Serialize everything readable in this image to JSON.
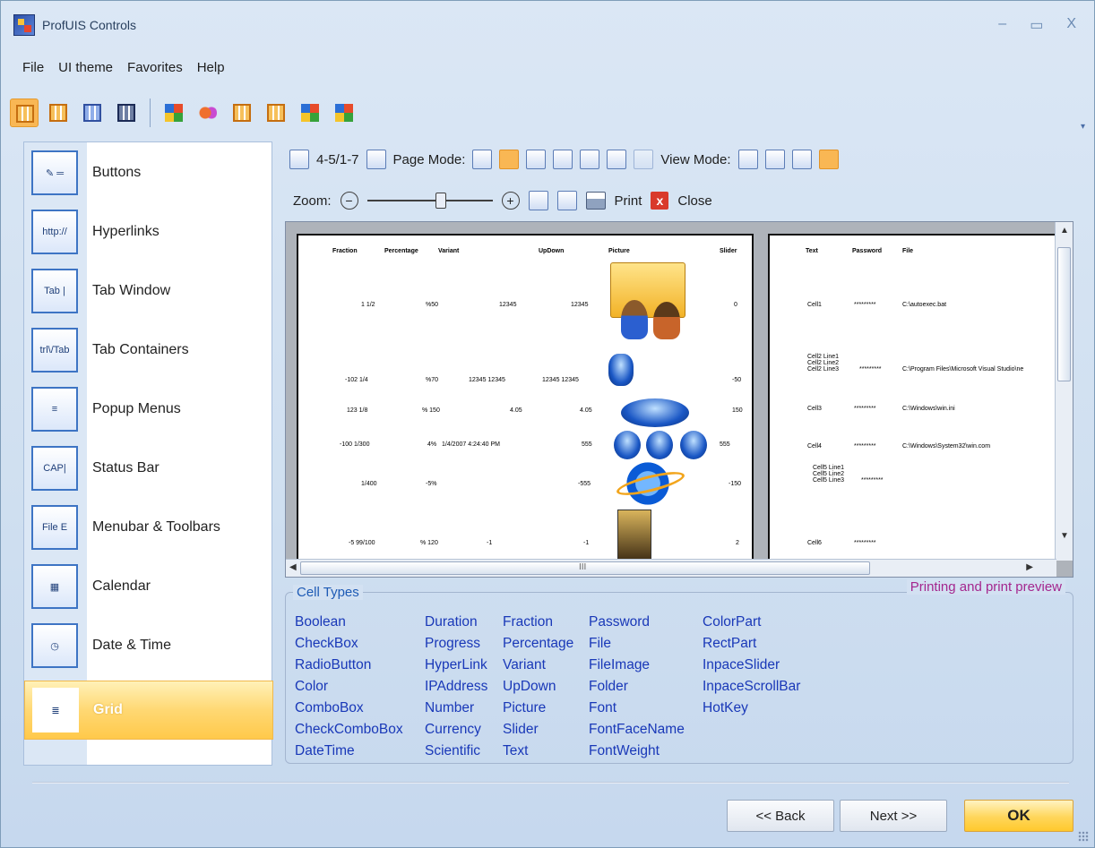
{
  "window": {
    "title": "ProfUIS Controls",
    "controls": [
      "–",
      "▭",
      "X"
    ]
  },
  "menu": [
    "File",
    "UI theme",
    "Favorites",
    "Help"
  ],
  "toolbar": {
    "icons": [
      "grid-icon-orange-1",
      "grid-icon-orange-2",
      "grid-icon-blue",
      "grid-icon-navy",
      "windows-xp-icon",
      "chain-link-icon",
      "grid-icon-orange-3",
      "grid-icon-orange-4",
      "office-icon",
      "windows-flag-icon"
    ]
  },
  "sidebar": {
    "items": [
      {
        "label": "Buttons",
        "icon_text": "✎ ═"
      },
      {
        "label": "Hyperlinks",
        "icon_text": "http://"
      },
      {
        "label": "Tab Window",
        "icon_text": "Tab |"
      },
      {
        "label": "Tab Containers",
        "icon_text": "trl\\/Tab"
      },
      {
        "label": "Popup Menus",
        "icon_text": "≡"
      },
      {
        "label": "Status Bar",
        "icon_text": "CAP|"
      },
      {
        "label": "Menubar & Toolbars",
        "icon_text": "File E"
      },
      {
        "label": "Calendar",
        "icon_text": "▦"
      },
      {
        "label": "Date & Time",
        "icon_text": "◷"
      },
      {
        "label": "Grid",
        "icon_text": "≣"
      }
    ],
    "active": "Grid"
  },
  "preview_toolbar": {
    "page_indicator": "4-5/1-7",
    "page_mode_label": "Page Mode:",
    "view_mode_label": "View Mode:",
    "zoom_label": "Zoom:",
    "zoom_level": 0.6,
    "print_label": "Print",
    "close_label": "Close"
  },
  "page1": {
    "headers": [
      "Fraction",
      "Percentage",
      "Variant",
      "UpDown",
      "Picture",
      "Slider"
    ],
    "rows": [
      [
        "1 1/2",
        "%50",
        "12345",
        "12345",
        "0"
      ],
      [
        "-102 1/4",
        "%70",
        "12345 12345",
        "12345 12345",
        "-50"
      ],
      [
        "123 1/8",
        "% 150",
        "4.05",
        "4.05",
        "150"
      ],
      [
        "-100 1/300",
        "4%",
        "1/4/2007 4:24:40 PM",
        "555",
        "555"
      ],
      [
        "1/400",
        "-5%",
        "",
        "-555",
        "-150"
      ],
      [
        "-5 99/100",
        "% 120",
        "-1",
        "-1",
        "2"
      ]
    ]
  },
  "page2": {
    "headers": [
      "Text",
      "Password",
      "File"
    ],
    "rows": [
      [
        "Cell1",
        "*********",
        "C:\\autoexec.bat"
      ],
      [
        "Cell2 Line1\nCell2 Line2\nCell2 Line3",
        "*********",
        "C:\\Program Files\\Microsoft Visual Studio\\ne"
      ],
      [
        "Cell3",
        "*********",
        "C:\\Windows\\win.ini"
      ],
      [
        "Cell4",
        "*********",
        "C:\\Windows\\System32\\win.com"
      ],
      [
        "Cell5 Line1\nCell5 Line2\nCell5 Line3",
        "*********",
        ""
      ],
      [
        "Cell6",
        "*********",
        ""
      ]
    ]
  },
  "hscroll_label": "III",
  "cell_types": {
    "legend": "Cell Types",
    "caption": "Printing and print preview",
    "columns": [
      [
        "Boolean",
        "CheckBox",
        "RadioButton",
        "Color",
        "ComboBox",
        "CheckComboBox",
        "DateTime"
      ],
      [
        "Duration",
        "Progress",
        "HyperLink",
        "IPAddress",
        "Number",
        "Currency",
        "Scientific"
      ],
      [
        "Fraction",
        "Percentage",
        "Variant",
        "UpDown",
        "Picture",
        "Slider",
        "Text"
      ],
      [
        "Password",
        "File",
        "FileImage",
        "Folder",
        "Font",
        "FontFaceName",
        "FontWeight"
      ],
      [
        "ColorPart",
        "RectPart",
        "InpaceSlider",
        "InpaceScrollBar",
        "HotKey"
      ]
    ]
  },
  "buttons": {
    "back": "<< Back",
    "next": "Next >>",
    "ok": "OK"
  }
}
